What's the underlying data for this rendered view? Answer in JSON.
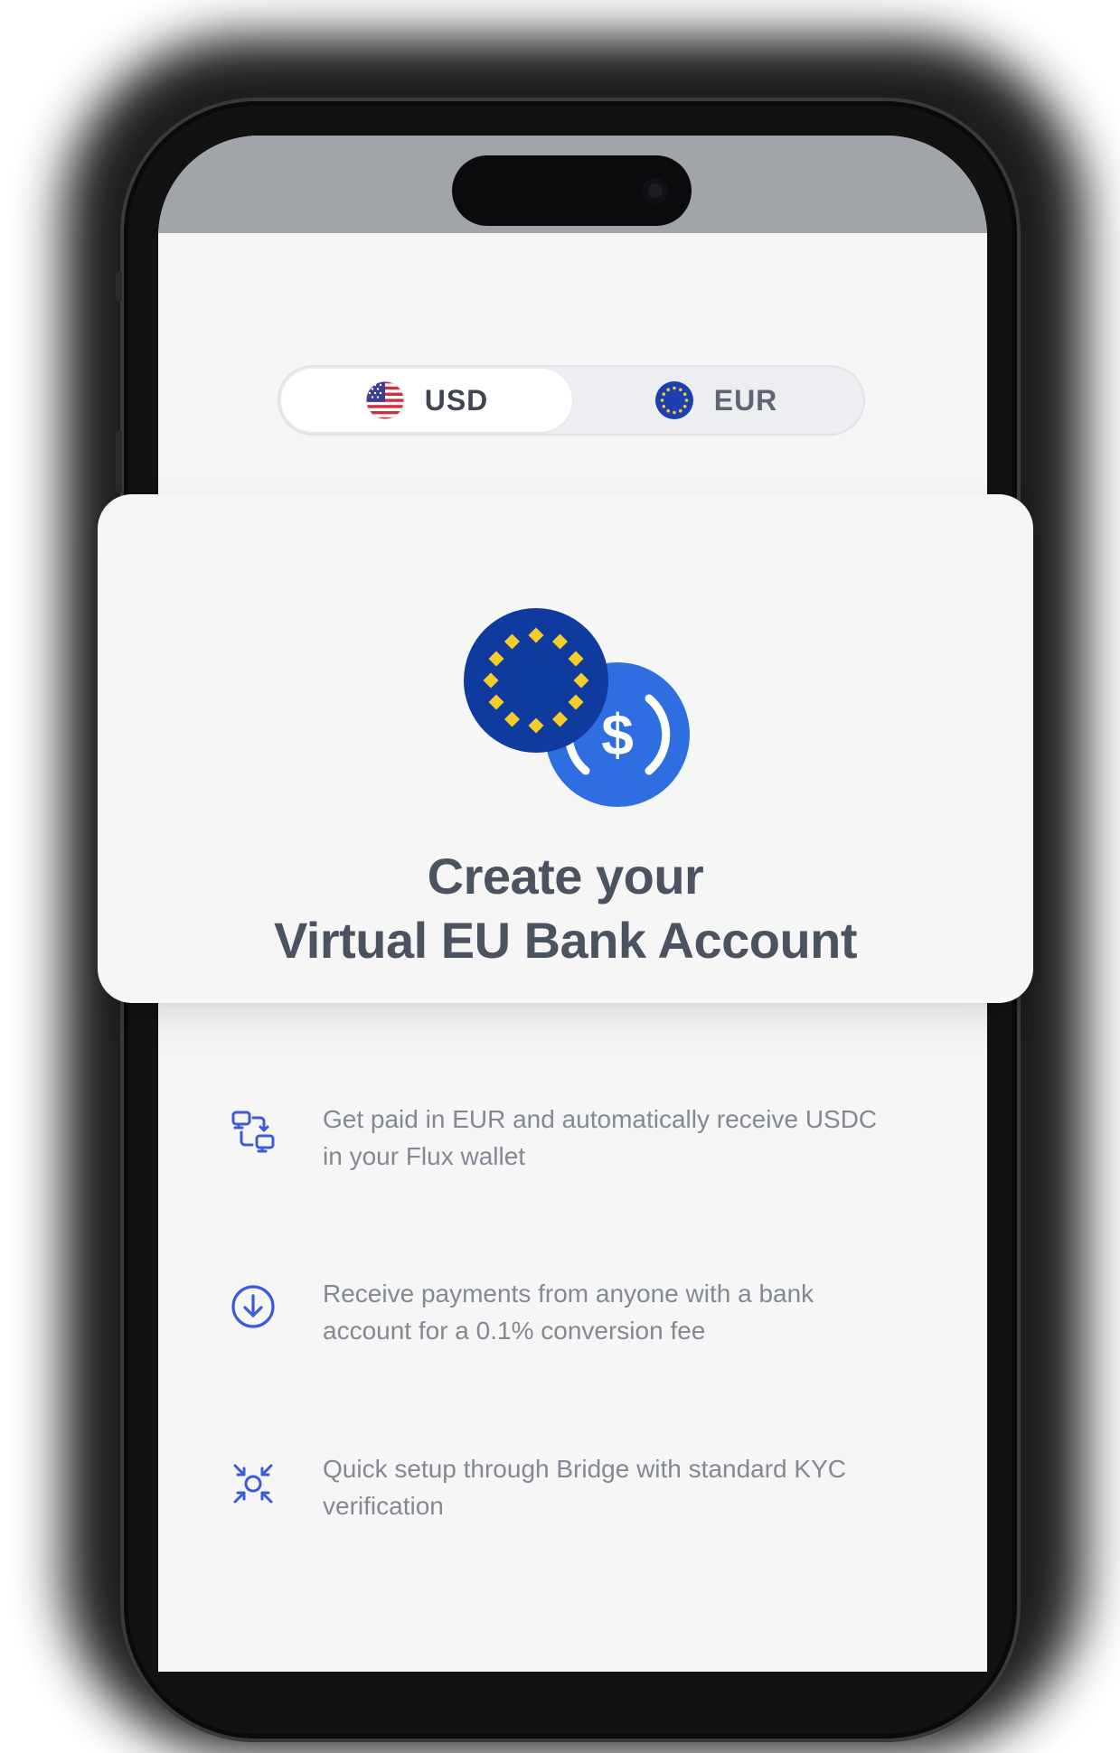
{
  "toggle": {
    "options": [
      {
        "label": "USD",
        "icon": "us-flag-icon",
        "selected": true
      },
      {
        "label": "EUR",
        "icon": "eu-flag-icon",
        "selected": false
      }
    ]
  },
  "card": {
    "title_line1": "Create your",
    "title_line2": "Virtual EU Bank Account",
    "icons": [
      "eu-coin-icon",
      "usdc-coin-icon"
    ]
  },
  "features": [
    {
      "icon": "conversion-flow-icon",
      "text": "Get paid in EUR and automatically receive USDC in your Flux wallet"
    },
    {
      "icon": "download-circle-icon",
      "text": "Receive payments from anyone with a bank account for a 0.1% conversion fee"
    },
    {
      "icon": "focus-arrows-icon",
      "text": "Quick setup through Bridge with standard KYC verification"
    }
  ],
  "colors": {
    "accent": "#3b5bdb",
    "eu_blue": "#0f3a9e",
    "eu_star": "#f5cc2a",
    "usdc_blue": "#2f6ee0",
    "title": "#4b5260",
    "body_text": "#838993"
  }
}
